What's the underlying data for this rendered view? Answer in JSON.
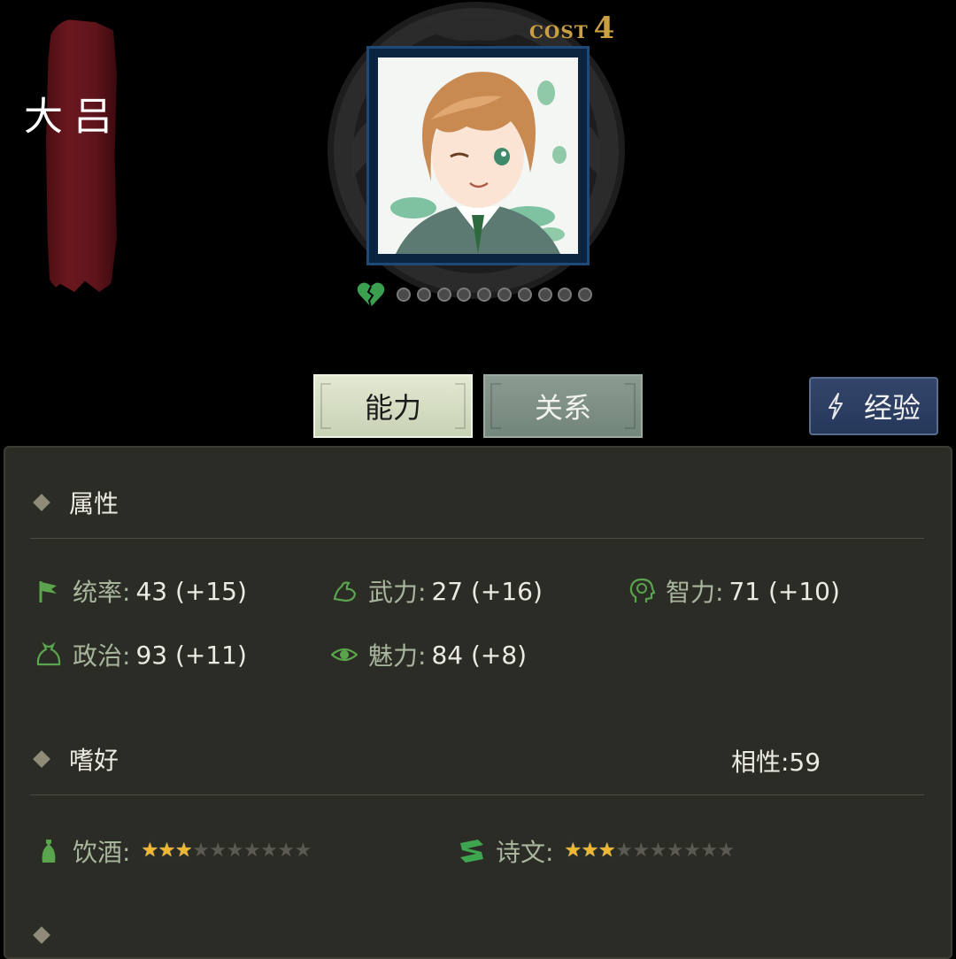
{
  "character": {
    "name_chars": [
      "吕",
      "大"
    ]
  },
  "cost": {
    "label": "COST",
    "value": "4"
  },
  "affection": {
    "filled": 0,
    "total": 10
  },
  "tabs": [
    {
      "label": "能力",
      "active": true
    },
    {
      "label": "关系",
      "active": false
    }
  ],
  "exp_button": {
    "label": "经验"
  },
  "attributes": {
    "title": "属性",
    "stats": [
      {
        "icon": "flag-icon",
        "label": "统率:",
        "value": "43 (+15)"
      },
      {
        "icon": "muscle-arm-icon",
        "label": "武力:",
        "value": "27 (+16)"
      },
      {
        "icon": "brain-head-icon",
        "label": "智力:",
        "value": "71 (+10)"
      },
      {
        "icon": "money-bag-icon",
        "label": "政治:",
        "value": "93 (+11)"
      },
      {
        "icon": "eye-icon",
        "label": "魅力:",
        "value": "84 (+8)"
      }
    ]
  },
  "hobbies": {
    "title": "嗜好",
    "affinity": "相性:59",
    "items": [
      {
        "icon": "wine-bottle-icon",
        "label": "饮酒:",
        "stars_filled": 3,
        "stars_total": 10
      },
      {
        "icon": "scroll-icon",
        "label": "诗文:",
        "stars_filled": 3,
        "stars_total": 10
      }
    ]
  },
  "colors": {
    "accent_green": "#5aa44e",
    "star_gold": "#f0b830",
    "panel_bg": "#2c2c26",
    "banner_red": "#6b1820"
  }
}
